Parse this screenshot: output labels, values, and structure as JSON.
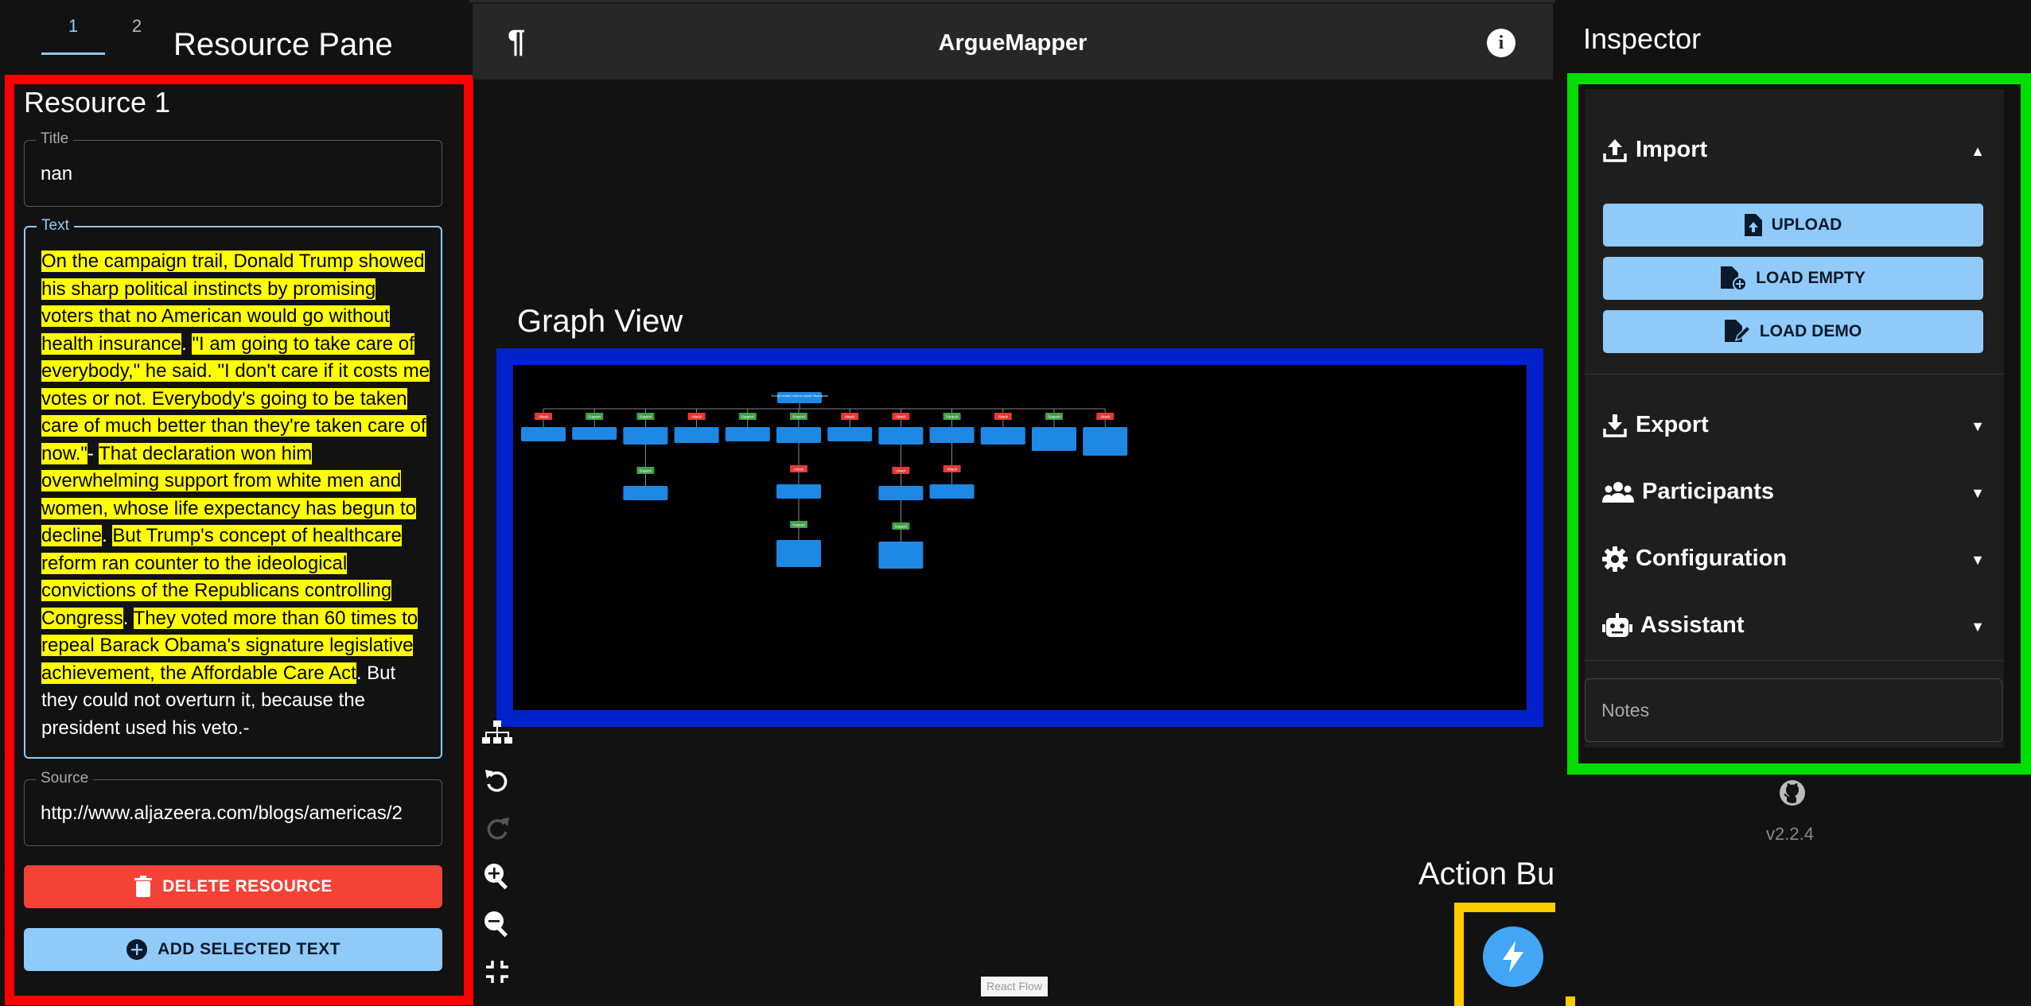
{
  "left_pane": {
    "tabs": [
      "1",
      "2"
    ],
    "overlay_label": "Resource Pane",
    "resource_title": "Resource 1",
    "title_field": {
      "label": "Title",
      "value": "nan"
    },
    "text_field": {
      "label": "Text",
      "segments": [
        {
          "text": "On the campaign trail, Donald Trump showed his sharp political instincts by promising voters that no American would go without health insurance",
          "highlight": true
        },
        {
          "text": ". ",
          "highlight": false
        },
        {
          "text": "\"I am going to take care of everybody,\" he said. \"I don't care if it costs me votes or not. Everybody's going to be taken care of much better than they're taken care of now.\"",
          "highlight": true
        },
        {
          "text": "- ",
          "highlight": false
        },
        {
          "text": "That declaration won him overwhelming support from white men and women, whose life expectancy has begun to decline",
          "highlight": true
        },
        {
          "text": ". ",
          "highlight": false
        },
        {
          "text": "But Trump's concept of healthcare reform ran counter to the ideological convictions of the Republicans controlling Congress",
          "highlight": true
        },
        {
          "text": ". ",
          "highlight": false
        },
        {
          "text": "They voted more than 60 times to repeal Barack Obama's signature legislative achievement, the Affordable Care Act",
          "highlight": true
        },
        {
          "text": ". But they could not overturn it, because the president used his veto.-",
          "highlight": false
        }
      ]
    },
    "source_field": {
      "label": "Source",
      "value": "http://www.aljazeera.com/blogs/americas/2"
    },
    "delete_button": "DELETE RESOURCE",
    "add_button": "ADD SELECTED TEXT"
  },
  "app_bar": {
    "title": "ArgueMapper",
    "left_icon": "pilcrow-icon",
    "right_icon": "info-icon"
  },
  "graph": {
    "overlay_label": "Graph View",
    "root_node": "Trump's stalled vows to repeal Obamacare",
    "columns": [
      {
        "relation": "Attack",
        "children": []
      },
      {
        "relation": "Support",
        "children": []
      },
      {
        "relation": "Support",
        "children": [
          "Support"
        ]
      },
      {
        "relation": "Attack",
        "children": []
      },
      {
        "relation": "Support",
        "children": []
      },
      {
        "relation": "Support",
        "children": [
          "Attack",
          "Support"
        ]
      },
      {
        "relation": "Attack",
        "children": []
      },
      {
        "relation": "Attack",
        "children": [
          "Attack",
          "Support"
        ]
      },
      {
        "relation": "Support",
        "children": [
          "Attack"
        ]
      },
      {
        "relation": "Attack",
        "children": []
      },
      {
        "relation": "Support",
        "children": []
      },
      {
        "relation": "Attack",
        "children": []
      }
    ],
    "controls": [
      "layout-icon",
      "undo-icon",
      "redo-icon",
      "zoom-in-icon",
      "zoom-out-icon",
      "fit-view-icon"
    ],
    "attribution": "React Flow"
  },
  "action_button": {
    "overlay_label": "Action Button",
    "icon": "bolt-icon"
  },
  "inspector": {
    "title": "Inspector",
    "sections": [
      {
        "label": "Import",
        "icon": "upload-icon",
        "expanded": true
      },
      {
        "label": "Export",
        "icon": "download-icon",
        "expanded": false
      },
      {
        "label": "Participants",
        "icon": "people-icon",
        "expanded": false
      },
      {
        "label": "Configuration",
        "icon": "gear-icon",
        "expanded": false
      },
      {
        "label": "Assistant",
        "icon": "robot-icon",
        "expanded": false
      }
    ],
    "import_buttons": [
      "UPLOAD",
      "LOAD EMPTY",
      "LOAD DEMO"
    ],
    "notes_placeholder": "Notes",
    "version": "v2.2.4"
  },
  "colors": {
    "resource_box": "#ff0000",
    "graph_box": "#0022cc",
    "inspector_box": "#00dd00",
    "action_box": "#ffcc00",
    "highlight": "#ffff00",
    "support": "#43a047",
    "attack": "#e53935",
    "node": "#1e88e5",
    "accent": "#90caf9"
  }
}
